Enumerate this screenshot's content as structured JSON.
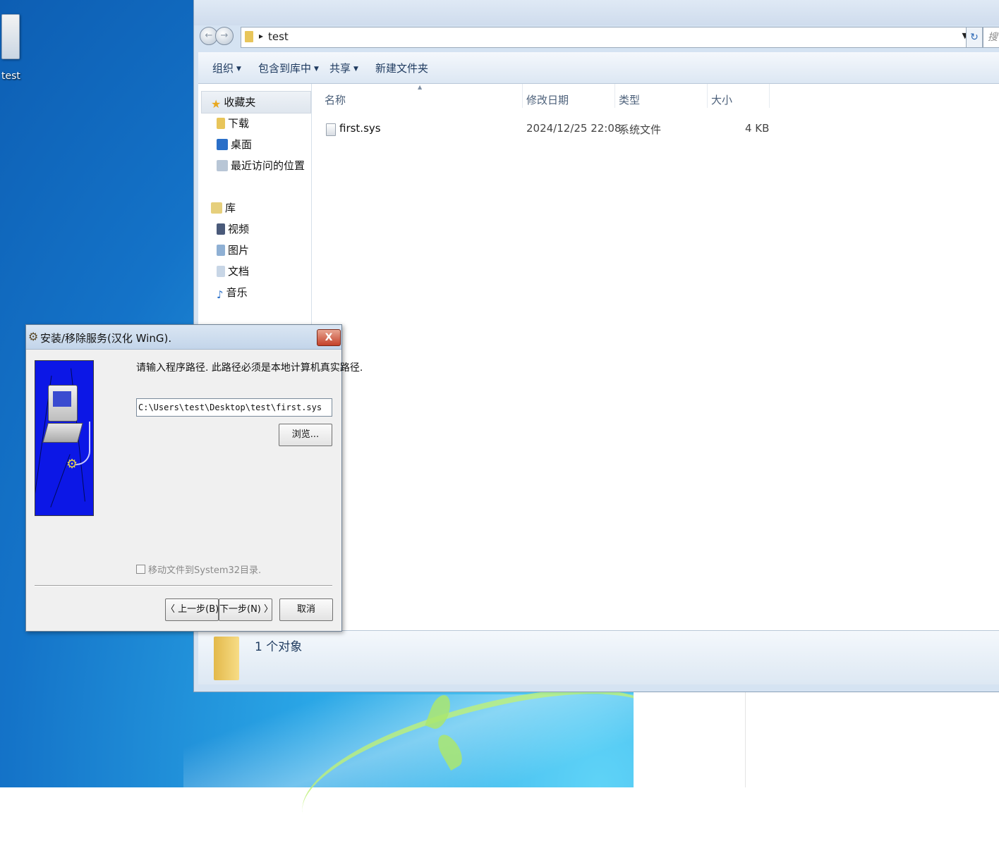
{
  "desktop": {
    "icon_label": "test"
  },
  "explorer": {
    "address": {
      "path": "test"
    },
    "search_placeholder": "搜",
    "toolbar": {
      "organize": "组织",
      "include_in_library": "包含到库中",
      "share": "共享",
      "new_folder": "新建文件夹"
    },
    "nav": {
      "favorites": "收藏夹",
      "downloads": "下载",
      "desktop": "桌面",
      "recent_places": "最近访问的位置",
      "libraries": "库",
      "videos": "视频",
      "pictures": "图片",
      "documents": "文档",
      "music": "音乐"
    },
    "columns": {
      "name": "名称",
      "modified": "修改日期",
      "type": "类型",
      "size": "大小"
    },
    "files": [
      {
        "name": "first.sys",
        "modified": "2024/12/25 22:08",
        "type": "系统文件",
        "size": "4 KB"
      }
    ],
    "details": {
      "count": "1 个对象"
    }
  },
  "dialog": {
    "title": "安装/移除服务(汉化 WinG).",
    "close_symbol": "X",
    "prompt": "请输入程序路径. 此路径必须是本地计算机真实路径.",
    "path_value": "C:\\Users\\test\\Desktop\\test\\first.sys",
    "browse_label": "浏览...",
    "move_checkbox_label": "移动文件到System32目录.",
    "back_label": "〈 上一步(B)",
    "next_label": "下一步(N) 〉",
    "cancel_label": "取消"
  },
  "colors": {
    "dialog_art_bg": "#0c17e6",
    "close_button": "#c4412a",
    "desktop_blue": "#1473c8"
  }
}
